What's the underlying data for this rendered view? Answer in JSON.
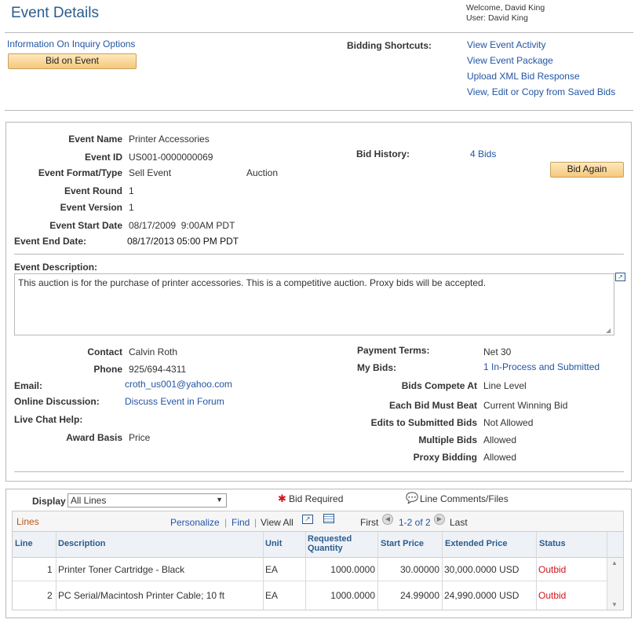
{
  "header": {
    "title": "Event Details",
    "welcome": "Welcome, David King",
    "user": "User: David King"
  },
  "top": {
    "inquiry_link": "Information On Inquiry Options",
    "bid_button": "Bid on Event",
    "shortcuts_label": "Bidding Shortcuts:",
    "shortcuts": [
      "View Event Activity",
      "View Event Package",
      "Upload XML Bid Response",
      "View, Edit or Copy from Saved Bids"
    ]
  },
  "event": {
    "name_label": "Event Name",
    "name": "Printer Accessories",
    "id_label": "Event ID",
    "id": "US001-0000000069",
    "format_label": "Event Format/Type",
    "format": "Sell Event",
    "type": "Auction",
    "round_label": "Event Round",
    "round": "1",
    "version_label": "Event Version",
    "version": "1",
    "start_label": "Event Start Date",
    "start": "08/17/2009  9:00AM PDT",
    "end_label": "Event End Date:",
    "end": "08/17/2013 05:00 PM PDT",
    "bid_history_label": "Bid History:",
    "bid_history": "4 Bids",
    "bid_again": "Bid Again",
    "desc_label": "Event Description:",
    "description": "This auction is for the purchase of printer accessories.  This is a competitive auction.  Proxy bids will be accepted."
  },
  "details": {
    "contact_label": "Contact",
    "contact": "Calvin Roth",
    "phone_label": "Phone",
    "phone": "925/694-4311",
    "email_label": "Email:",
    "email": "croth_us001@yahoo.com",
    "discussion_label": "Online Discussion:",
    "discussion": "Discuss Event in Forum",
    "chat_label": "Live Chat Help:",
    "award_label": "Award Basis",
    "award": "Price",
    "payment_label": "Payment Terms:",
    "payment": "Net 30",
    "mybids_label": "My Bids:",
    "mybids": "1 In-Process and Submitted",
    "compete_label": "Bids Compete At",
    "compete": "Line Level",
    "beat_label": "Each Bid Must Beat",
    "beat": "Current Winning Bid",
    "edits_label": "Edits to Submitted Bids",
    "edits": "Not Allowed",
    "multiple_label": "Multiple Bids",
    "multiple": "Allowed",
    "proxy_label": "Proxy Bidding",
    "proxy": "Allowed"
  },
  "lines": {
    "display_label": "Display",
    "display_value": "All Lines",
    "bid_required": "Bid Required",
    "line_comments": "Line Comments/Files",
    "grid_title": "Lines",
    "personalize": "Personalize",
    "find": "Find",
    "view_all": "View All",
    "first": "First",
    "range": "1-2 of 2",
    "last": "Last",
    "columns": [
      "Line",
      "Description",
      "Unit",
      "Requested Quantity",
      "Start Price",
      "Extended Price",
      "Status"
    ],
    "rows": [
      {
        "line": "1",
        "description": "Printer Toner Cartridge - Black",
        "unit": "EA",
        "qty": "1000.0000",
        "start": "30.00000",
        "extended": "30,000.0000 USD",
        "status": "Outbid"
      },
      {
        "line": "2",
        "description": "PC Serial/Macintosh Printer Cable; 10 ft",
        "unit": "EA",
        "qty": "1000.0000",
        "start": "24.99000",
        "extended": "24,990.0000 USD",
        "status": "Outbid"
      }
    ]
  }
}
